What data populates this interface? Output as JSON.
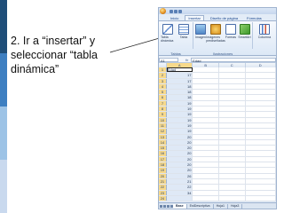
{
  "slide": {
    "instruction": "2. Ir a “insertar” y seleccionar “tabla dinámica”",
    "accent_colors": [
      "#1f4e79",
      "#3e7fc1",
      "#9dc3e6",
      "#c9d9ee"
    ]
  },
  "excel": {
    "title_hint": "Libro",
    "tabs": [
      "Inicio",
      "Insertar",
      "Diseño de página",
      "Fórmulas"
    ],
    "active_tab": "Insertar",
    "ribbon": {
      "tables_group": "Tablas",
      "illustrations_group": "Ilustraciones",
      "buttons": {
        "pivot": "Tabla dinámica",
        "table": "Tabla",
        "image": "Imagen",
        "clipart": "Imágenes prediseñadas",
        "shapes": "Formas",
        "smartart": "SmartArt",
        "column": "Columna"
      }
    },
    "name_box": "A1",
    "fx": "fx",
    "formula": "Edad",
    "columns": [
      "A",
      "B",
      "C",
      "D"
    ],
    "rows": [
      {
        "n": "1",
        "a": "Edad"
      },
      {
        "n": "2",
        "a": "17"
      },
      {
        "n": "3",
        "a": "17"
      },
      {
        "n": "4",
        "a": "18"
      },
      {
        "n": "5",
        "a": "18"
      },
      {
        "n": "6",
        "a": "18"
      },
      {
        "n": "7",
        "a": "19"
      },
      {
        "n": "8",
        "a": "19"
      },
      {
        "n": "9",
        "a": "19"
      },
      {
        "n": "10",
        "a": "19"
      },
      {
        "n": "11",
        "a": "19"
      },
      {
        "n": "12",
        "a": "19"
      },
      {
        "n": "13",
        "a": "20"
      },
      {
        "n": "14",
        "a": "20"
      },
      {
        "n": "15",
        "a": "20"
      },
      {
        "n": "16",
        "a": "20"
      },
      {
        "n": "17",
        "a": "20"
      },
      {
        "n": "18",
        "a": "20"
      },
      {
        "n": "19",
        "a": "20"
      },
      {
        "n": "20",
        "a": "26"
      },
      {
        "n": "21",
        "a": "21"
      },
      {
        "n": "22",
        "a": "22"
      },
      {
        "n": "23",
        "a": "34"
      },
      {
        "n": "24",
        "a": ""
      }
    ],
    "sheet_tabs": [
      "Base",
      "EstDescriptiva",
      "Hoja1",
      "Hoja3"
    ],
    "active_sheet": "Base"
  }
}
